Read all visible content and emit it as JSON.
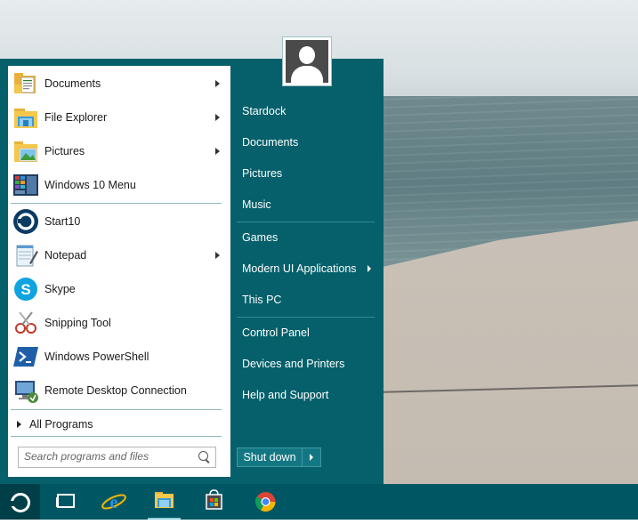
{
  "left_panel": {
    "items": [
      {
        "label": "Documents",
        "icon": "documents-folder-icon",
        "has_arrow": true
      },
      {
        "label": "File Explorer",
        "icon": "file-explorer-icon",
        "has_arrow": true
      },
      {
        "label": "Pictures",
        "icon": "pictures-folder-icon",
        "has_arrow": true
      },
      {
        "label": "Windows 10 Menu",
        "icon": "windows10-menu-icon",
        "has_arrow": false
      },
      {
        "label": "Start10",
        "icon": "start10-icon",
        "has_arrow": false
      },
      {
        "label": "Notepad",
        "icon": "notepad-icon",
        "has_arrow": true
      },
      {
        "label": "Skype",
        "icon": "skype-icon",
        "has_arrow": false
      },
      {
        "label": "Snipping Tool",
        "icon": "snipping-tool-icon",
        "has_arrow": false
      },
      {
        "label": "Windows PowerShell",
        "icon": "powershell-icon",
        "has_arrow": false
      },
      {
        "label": "Remote Desktop Connection",
        "icon": "remote-desktop-icon",
        "has_arrow": false
      }
    ],
    "all_programs": "All Programs",
    "search_placeholder": "Search programs and files"
  },
  "right_panel": {
    "user": "Stardock",
    "items": [
      {
        "label": "Documents"
      },
      {
        "label": "Pictures"
      },
      {
        "label": "Music"
      },
      {
        "label": "Games"
      },
      {
        "label": "Modern UI Applications",
        "has_arrow": true
      },
      {
        "label": "This PC"
      },
      {
        "label": "Control Panel"
      },
      {
        "label": "Devices and Printers"
      },
      {
        "label": "Help and Support"
      }
    ],
    "shutdown_label": "Shut down"
  },
  "taskbar": {
    "icons": [
      "start10-orb-icon",
      "task-view-icon",
      "internet-explorer-icon",
      "file-explorer-icon",
      "store-icon",
      "chrome-icon"
    ],
    "active": "file-explorer-icon"
  },
  "colors": {
    "menu_bg": "#05606b",
    "taskbar_bg": "#005763",
    "separator": "#8fb8bd"
  }
}
